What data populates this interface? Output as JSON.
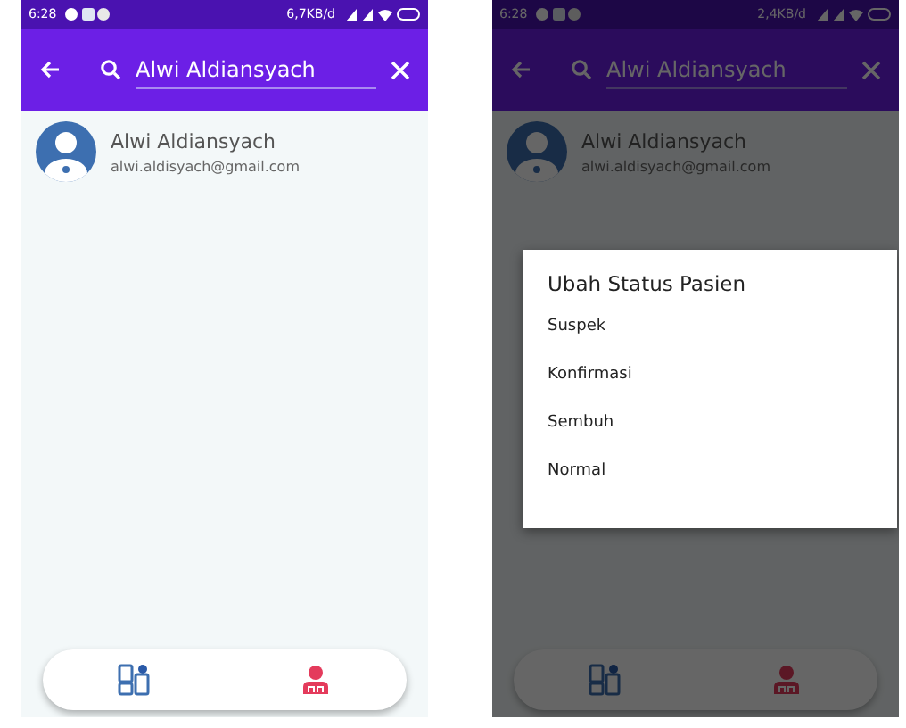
{
  "phones": [
    {
      "status_bar": {
        "time": "6:28",
        "speed": "6,7KB/d"
      },
      "search": {
        "value": "Alwi Aldiansyach"
      },
      "results": [
        {
          "name": "Alwi Aldiansyach",
          "email": "alwi.aldisyach@gmail.com"
        }
      ]
    },
    {
      "status_bar": {
        "time": "6:28",
        "speed": "2,4KB/d"
      },
      "search": {
        "value": "Alwi Aldiansyach"
      },
      "results": [
        {
          "name": "Alwi Aldiansyach",
          "email": "alwi.aldisyach@gmail.com"
        }
      ],
      "dialog": {
        "title": "Ubah Status Pasien",
        "options": [
          "Suspek",
          "Konfirmasi",
          "Sembuh",
          "Normal"
        ]
      }
    }
  ]
}
